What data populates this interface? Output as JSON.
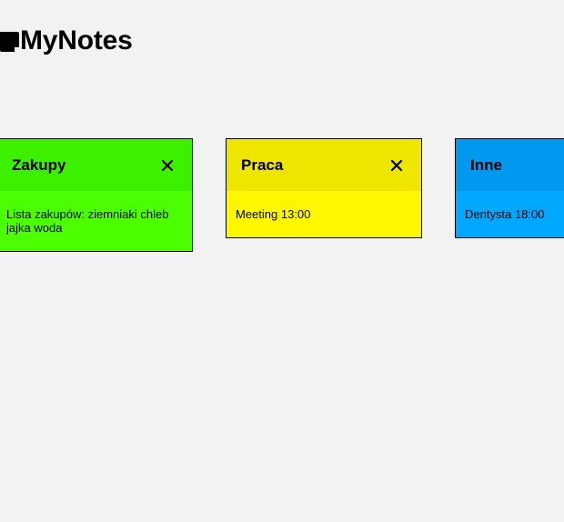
{
  "app": {
    "title": "MyNotes",
    "logo_icon": "note-icon"
  },
  "notes": [
    {
      "title": "Zakupy",
      "content": "Lista zakupów: ziemniaki chleb jajka woda",
      "header_color": "#3df000",
      "body_color": "#4cff00",
      "close_icon": "close-icon"
    },
    {
      "title": "Praca",
      "content": "Meeting 13:00",
      "header_color": "#efe600",
      "body_color": "#fff700",
      "close_icon": "close-icon"
    },
    {
      "title": "Inne",
      "content": "Dentysta 18:00",
      "header_color": "#0099f0",
      "body_color": "#00a8ff",
      "close_icon": "close-icon"
    }
  ]
}
